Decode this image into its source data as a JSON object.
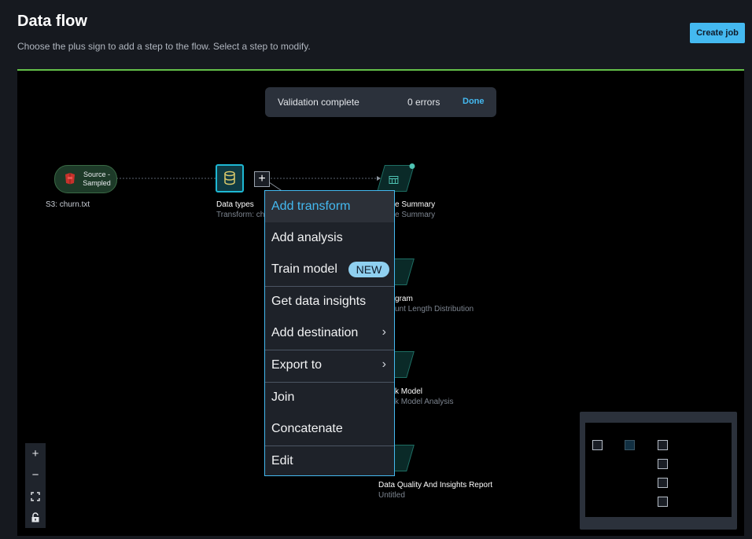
{
  "header": {
    "title": "Data flow",
    "subtitle": "Choose the plus sign to add a step to the flow. Select a step to modify.",
    "create_job_label": "Create job"
  },
  "validation": {
    "message": "Validation complete",
    "errors": "0 errors",
    "done_label": "Done"
  },
  "nodes": {
    "source": {
      "label": "Source - Sampled",
      "caption": "S3: churn.txt",
      "icon": "s3-bucket-icon"
    },
    "data_types": {
      "title": "Data types",
      "subtitle": "Transform: ch",
      "icon": "database-icon"
    },
    "summary": {
      "title": "e Summary",
      "subtitle": "e Summary",
      "icon": "table-icon"
    },
    "histogram": {
      "title": "gram",
      "subtitle": "unt Length Distribution",
      "icon": "chart-icon"
    },
    "quick_model": {
      "title": "k Model",
      "subtitle": "k Model Analysis",
      "icon": "chart-icon"
    },
    "dq_report": {
      "title": "Data Quality And Insights Report",
      "subtitle": "Untitled",
      "icon": "report-icon"
    }
  },
  "context_menu": {
    "items": [
      {
        "label": "Add transform",
        "active": true
      },
      {
        "label": "Add analysis"
      },
      {
        "label": "Train model",
        "badge": "NEW"
      },
      {
        "label": "Get data insights"
      },
      {
        "label": "Add destination",
        "submenu": true
      },
      {
        "label": "Export to",
        "submenu": true
      },
      {
        "label": "Join"
      },
      {
        "label": "Concatenate"
      },
      {
        "label": "Edit"
      }
    ]
  },
  "zoom_controls": {
    "zoom_in": "+",
    "zoom_out": "−",
    "fit_icon": "fit-view-icon",
    "lock_icon": "lock-icon"
  },
  "colors": {
    "accent": "#44b9f0",
    "canvas_border": "#64bf49",
    "source_node": "#1d3a28",
    "selected_node": "#1eb8d4"
  }
}
